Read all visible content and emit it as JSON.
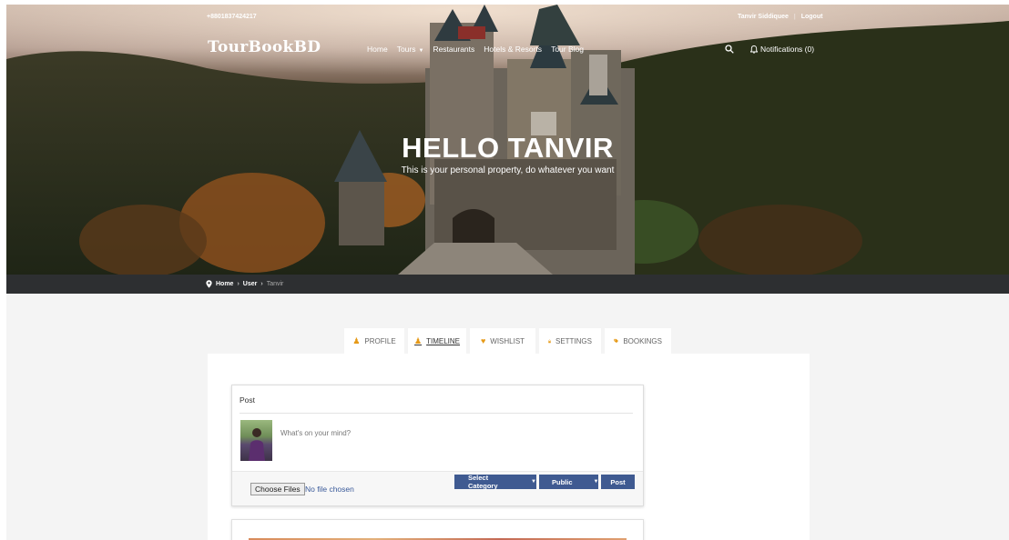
{
  "topbar": {
    "phone": "+8801837424217",
    "user_name": "Tanvir Siddiquee",
    "logout": "Logout"
  },
  "brand": {
    "logo": "TourBookBD"
  },
  "nav": {
    "items": [
      "Home",
      "Tours",
      "Restaurants",
      "Hotels & Resorts",
      "Tour Blog"
    ],
    "notifications": "Notifications (0)"
  },
  "hero": {
    "title": "HELLO TANVIR",
    "subtitle": "This is your personal property, do whatever you want"
  },
  "breadcrumb": [
    "Home",
    "User",
    "Tanvir"
  ],
  "tabs": [
    {
      "label": "PROFILE",
      "icon": "user-icon"
    },
    {
      "label": "TIMELINE",
      "icon": "user-icon",
      "active": true
    },
    {
      "label": "WISHLIST",
      "icon": "heart-icon"
    },
    {
      "label": "SETTINGS",
      "icon": "lock-icon"
    },
    {
      "label": "BOOKINGS",
      "icon": "tag-icon"
    }
  ],
  "post": {
    "heading": "Post",
    "placeholder": "What's on your mind?",
    "file_button": "Choose Files",
    "file_status": "No file chosen",
    "category_select": "Select Category",
    "privacy_select": "Public",
    "submit": "Post"
  },
  "colors": {
    "accent_orange": "#e69a18",
    "button_blue": "#3f5a91",
    "breadcrumb_bg": "#2d2f31"
  }
}
